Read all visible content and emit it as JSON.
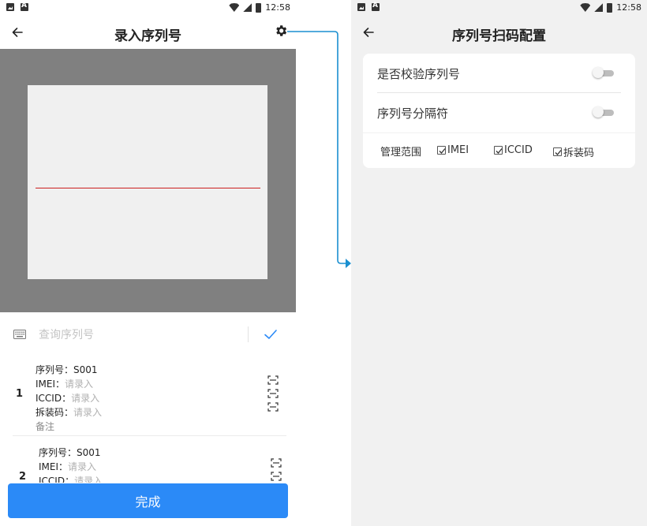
{
  "status": {
    "time": "12:58"
  },
  "left": {
    "title": "录入序列号",
    "search": {
      "placeholder": "查询序列号",
      "value": ""
    },
    "items": [
      {
        "index": "1",
        "serial_label": "序列号：",
        "serial_value": "S001",
        "imei_label": "IMEI：",
        "imei_placeholder": "请录入",
        "iccid_label": "ICCID：",
        "iccid_placeholder": "请录入",
        "unpack_label": "拆装码：",
        "unpack_placeholder": "请录入",
        "note": "备注"
      },
      {
        "index": "2",
        "serial_label": "序列号：",
        "serial_value": "S001",
        "imei_label": "IMEI：",
        "imei_placeholder": "请录入",
        "iccid_label": "ICCID：",
        "iccid_placeholder": "请录入"
      }
    ],
    "done_label": "完成",
    "accent_color": "#2b8af7",
    "scan_line_color": "#cc1f1f"
  },
  "right": {
    "title": "序列号扫码配置",
    "settings": [
      {
        "label": "是否校验序列号",
        "enabled": false
      },
      {
        "label": "序列号分隔符",
        "enabled": false
      }
    ],
    "range_label": "管理范围",
    "range_options": [
      {
        "label": "IMEI",
        "checked": true
      },
      {
        "label": "ICCID",
        "checked": true
      },
      {
        "label": "拆装码",
        "checked": true
      }
    ]
  },
  "connector_color": "#1a8fd0",
  "icons": [
    "back-icon",
    "gear-icon",
    "keyboard-icon",
    "check-icon",
    "scan-icon",
    "wifi-icon",
    "signal-icon",
    "battery-icon"
  ]
}
